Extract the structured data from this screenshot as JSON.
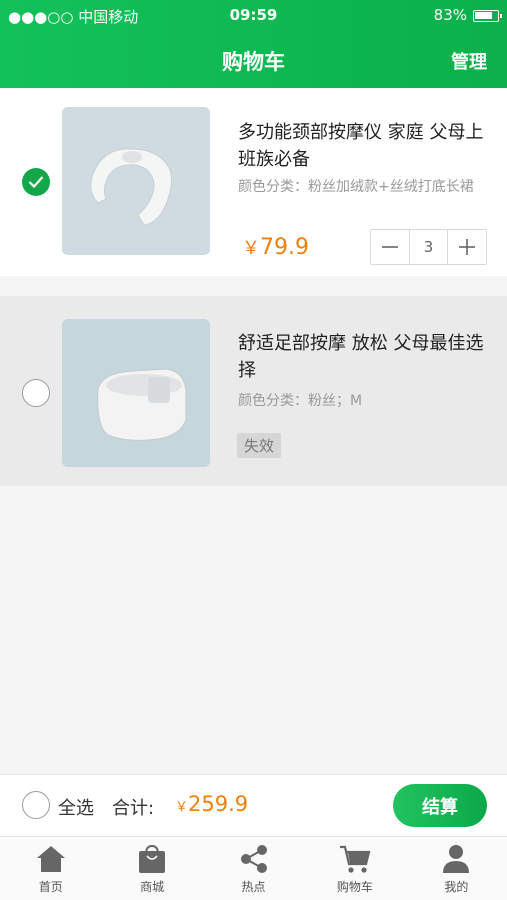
{
  "status_bar": {
    "carrier": "●●●○○ 中国移动",
    "time": "09:59",
    "battery": "83%",
    "battery_level": 0.83
  },
  "header": {
    "title": "购物车",
    "manage": "管理"
  },
  "items": [
    {
      "name": "多功能颈部按摩仪 家庭 父母上班族必备",
      "attr": "颜色分类：粉丝加绒款+丝绒打底长裙",
      "price_symbol": "￥",
      "price": "79.9",
      "quantity": "3",
      "selected": true
    },
    {
      "name": "舒适足部按摩 放松 父母最佳选择",
      "attr": "颜色分类：粉丝；M",
      "badge": "失效",
      "selected": false
    }
  ],
  "footer": {
    "select_all": "全选",
    "total_label": "合计:",
    "total_symbol": "￥",
    "total": "259.9",
    "checkout": "结算"
  },
  "tabs": [
    {
      "label": "首页",
      "icon": "home-icon"
    },
    {
      "label": "商城",
      "icon": "shopping-bag-icon"
    },
    {
      "label": "热点",
      "icon": "share-icon"
    },
    {
      "label": "购物车",
      "icon": "cart-icon"
    },
    {
      "label": "我的",
      "icon": "user-icon"
    }
  ],
  "colors": {
    "brand_green": "#13c15a",
    "price_orange": "#ef7f0e"
  }
}
